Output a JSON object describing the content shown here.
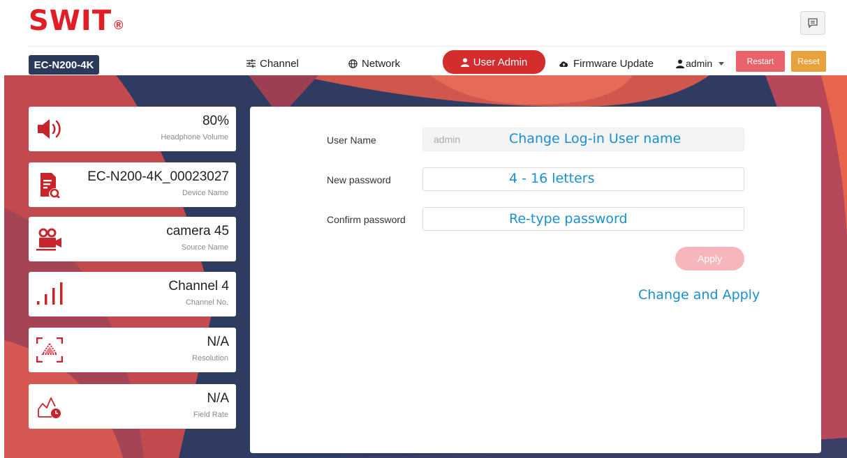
{
  "brand": {
    "name": "SWIT",
    "reg": "®"
  },
  "toolbar": {
    "message_icon": "message-icon"
  },
  "nav": {
    "device": "EC-N200-4K",
    "items": [
      {
        "label": "Channel",
        "icon": "sliders-icon"
      },
      {
        "label": "Network",
        "icon": "globe-icon"
      },
      {
        "label": "User Admin",
        "icon": "user-icon"
      },
      {
        "label": "Firmware Update",
        "icon": "cloud-upload-icon"
      }
    ],
    "active_index": 2,
    "user": "admin",
    "restart_label": "Restart",
    "reset_label": "Reset"
  },
  "cards": [
    {
      "value": "80%",
      "label": "Headphone Volume",
      "icon": "speaker-icon"
    },
    {
      "value": "EC-N200-4K_00023027",
      "label": "Device Name",
      "icon": "device-search-icon"
    },
    {
      "value": "camera 45",
      "label": "Source Name",
      "icon": "video-camera-icon"
    },
    {
      "value": "Channel 4",
      "label": "Channel No.",
      "icon": "signal-bars-icon"
    },
    {
      "value": "N/A",
      "label": "Resolution",
      "icon": "resolution-icon"
    },
    {
      "value": "N/A",
      "label": "Field Rate",
      "icon": "field-rate-icon"
    }
  ],
  "form": {
    "username_label": "User Name",
    "username_value": "admin",
    "new_password_label": "New password",
    "new_password_value": "",
    "confirm_password_label": "Confirm password",
    "confirm_password_value": "",
    "apply_label": "Apply"
  },
  "hints": {
    "username": "Change Log-in User name",
    "new_password": "4 - 16 letters",
    "confirm_password": "Re-type password",
    "apply": "Change and Apply"
  },
  "colors": {
    "brand_red": "#e21d25",
    "active_tab": "#d32d2d",
    "device_tag": "#2b3a5a",
    "restart": "#e8636b",
    "reset": "#e8a23c",
    "apply_disabled": "#f7b6bb",
    "hint_blue": "#1a8fd1",
    "icon_red": "#c8242b"
  }
}
